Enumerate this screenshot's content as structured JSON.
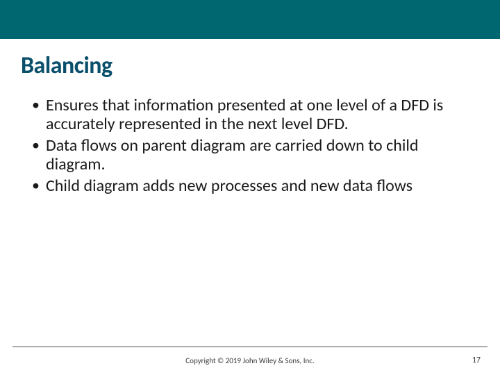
{
  "title": "Balancing",
  "bullets": [
    "Ensures that information presented at one level of a DFD is accurately represented in the next level DFD.",
    "Data flows on parent diagram are carried down to child diagram.",
    "Child diagram adds new processes and new data flows"
  ],
  "copyright": "Copyright © 2019 John Wiley & Sons, Inc.",
  "page_number": "17",
  "colors": {
    "accent": "#006670",
    "title": "#0a4f6b"
  }
}
